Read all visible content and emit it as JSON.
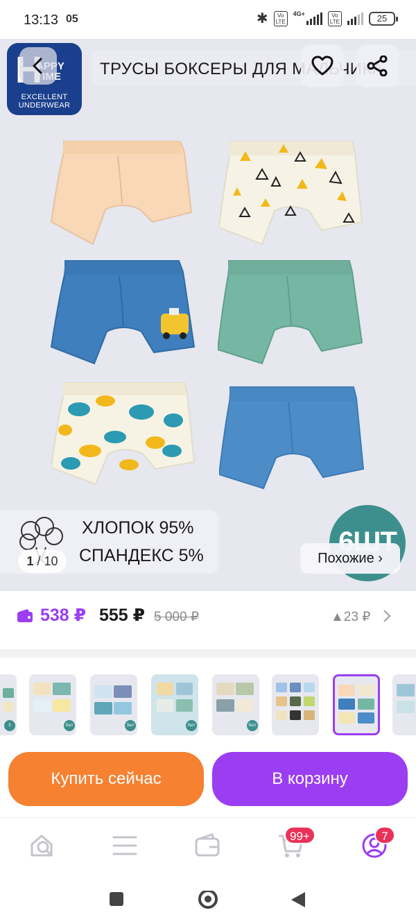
{
  "status_bar": {
    "time": "13:13",
    "extra": "05",
    "network": "4G+",
    "volte_label": "Vo LTE",
    "battery": "25"
  },
  "brand": {
    "initial": "H",
    "name_line1": "APPY",
    "name_line2": "TIME",
    "tagline_line1": "EXCELLENT",
    "tagline_line2": "UNDERWEAR"
  },
  "header": {
    "title": "ТРУСЫ БОКСЕРЫ ДЛЯ МАЛЬЧИКА"
  },
  "composition": {
    "line1": "ХЛОПОК 95%",
    "line2": "СПАНДЕКС 5%"
  },
  "gallery": {
    "current": "1",
    "separator": "/",
    "total": "10",
    "quantity_badge": "6ШТ",
    "similar_label": "Похожие ›"
  },
  "price": {
    "card_price": "538 ₽",
    "current_price": "555 ₽",
    "old_price": "5 000 ₽",
    "change": "▲23 ₽"
  },
  "actions": {
    "buy_now": "Купить сейчас",
    "add_to_cart": "В корзину"
  },
  "nav": {
    "cart_badge": "99+",
    "profile_badge": "7"
  },
  "colors": {
    "accent_purple": "#9b3df0",
    "buy_orange": "#f58131",
    "badge_red": "#e8325a",
    "badge_teal": "#3c8f8c",
    "image_bg": "#e6e7ef"
  },
  "icons": [
    "back-arrow-icon",
    "heart-icon",
    "share-icon",
    "cotton-icon",
    "wallet-icon",
    "chevron-right-icon",
    "home-search-icon",
    "catalog-menu-icon",
    "wallet-nav-icon",
    "cart-icon",
    "profile-icon",
    "square-icon",
    "circle-icon",
    "triangle-back-icon"
  ]
}
